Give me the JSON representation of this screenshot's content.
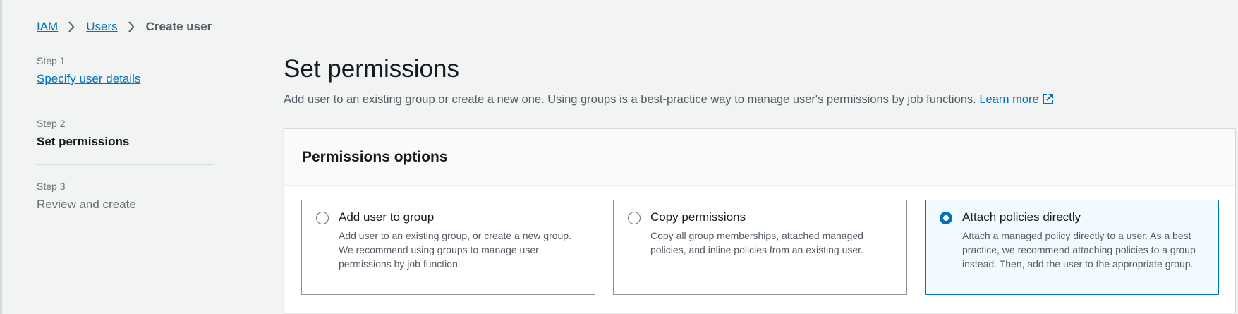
{
  "breadcrumb": {
    "items": [
      "IAM",
      "Users"
    ],
    "current": "Create user"
  },
  "steps": [
    {
      "num": "Step 1",
      "title": "Specify user details",
      "state": "completed"
    },
    {
      "num": "Step 2",
      "title": "Set permissions",
      "state": "active"
    },
    {
      "num": "Step 3",
      "title": "Review and create",
      "state": "future"
    }
  ],
  "main": {
    "title": "Set permissions",
    "description": "Add user to an existing group or create a new one. Using groups is a best-practice way to manage user's permissions by job functions.",
    "learn_more": "Learn more"
  },
  "card": {
    "title": "Permissions options",
    "options": [
      {
        "label": "Add user to group",
        "desc": "Add user to an existing group, or create a new group. We recommend using groups to manage user permissions by job function.",
        "selected": false
      },
      {
        "label": "Copy permissions",
        "desc": "Copy all group memberships, attached managed policies, and inline policies from an existing user.",
        "selected": false
      },
      {
        "label": "Attach policies directly",
        "desc": "Attach a managed policy directly to a user. As a best practice, we recommend attaching policies to a group instead. Then, add the user to the appropriate group.",
        "selected": true
      }
    ]
  },
  "colors": {
    "link": "#0073bb",
    "selected_border": "#0073bb",
    "selected_bg": "#f1faff",
    "page_bg": "#f2f3f3"
  }
}
